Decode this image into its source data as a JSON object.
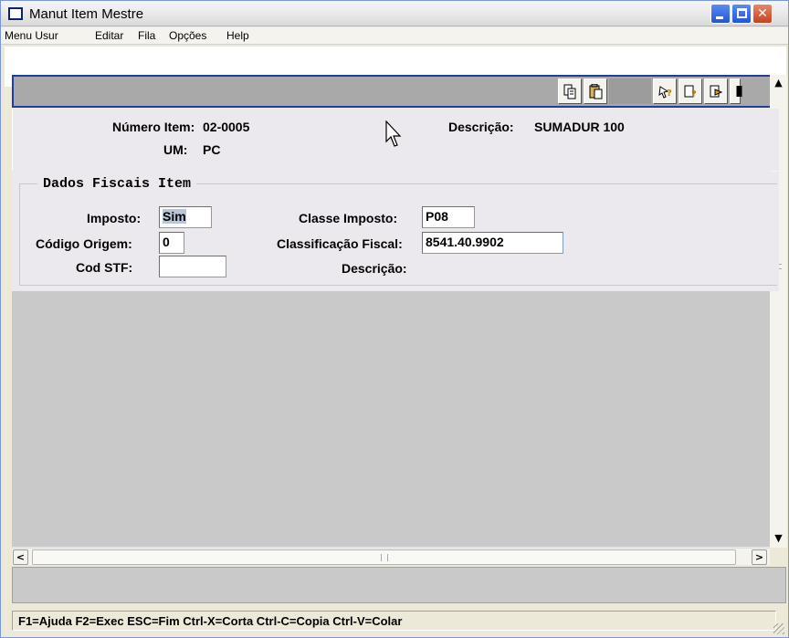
{
  "window": {
    "title": "Manut Item Mestre"
  },
  "menu": {
    "items": [
      "Menu Usur",
      "Editar",
      "Fila",
      "Opções",
      "Help"
    ]
  },
  "toolbar": {
    "icons": [
      "copy-icon",
      "paste-icon",
      "query-icon",
      "edit-query-icon",
      "navigate-icon",
      "exit-icon"
    ]
  },
  "item": {
    "numero_label": "Número Item:",
    "numero_value": "02-0005",
    "descricao_label": "Descrição:",
    "descricao_value": "SUMADUR 100",
    "um_label": "UM:",
    "um_value": "PC"
  },
  "fiscal": {
    "group_title": "Dados Fiscais Item",
    "imposto_label": "Imposto:",
    "imposto_value": "Sim",
    "codigo_origem_label": "Código Origem:",
    "codigo_origem_value": "0",
    "cod_stf_label": "Cod STF:",
    "cod_stf_value": "",
    "classe_imposto_label": "Classe Imposto:",
    "classe_imposto_value": "P08",
    "classificacao_fiscal_label": "Classificação Fiscal:",
    "classificacao_fiscal_value": "8541.40.9902",
    "descricao_label": "Descrição:"
  },
  "statusbar": {
    "text": "F1=Ajuda F2=Exec ESC=Fim Ctrl-X=Corta Ctrl-C=Copia Ctrl-V=Colar"
  }
}
